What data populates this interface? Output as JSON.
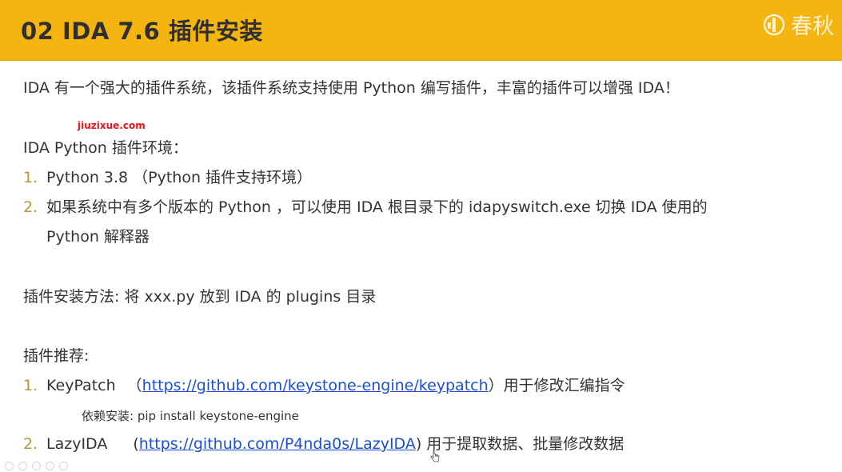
{
  "header": {
    "title": "02 IDA 7.6 插件安装",
    "brand_text": "春秋",
    "accent_color": "#f5b511"
  },
  "intro": "IDA 有一个强大的插件系统，该插件系统支持使用 Python 编写插件，丰富的插件可以增强 IDA！",
  "watermark": "jiuzixue.com",
  "env_section": {
    "heading": "IDA Python 插件环境：",
    "items": [
      {
        "num": "1.",
        "text": "Python 3.8 （Python 插件支持环境）"
      },
      {
        "num": "2.",
        "text": "如果系统中有多个版本的 Python ，可以使用 IDA 根目录下的 idapyswitch.exe 切换 IDA 使用的",
        "continuation": "Python 解释器"
      }
    ]
  },
  "install_method": "插件安装方法: 将 xxx.py 放到 IDA 的 plugins 目录",
  "recommend_section": {
    "heading": "插件推荐:",
    "items": [
      {
        "num": "1.",
        "name": "KeyPatch",
        "open": "（",
        "url": "https://github.com/keystone-engine/keypatch",
        "after": "）用于修改汇编指令",
        "sub_note": "依赖安装: pip install keystone-engine"
      },
      {
        "num": "2.",
        "name": "LazyIDA",
        "open": "(",
        "url": "https://github.com/P4nda0s/LazyIDA",
        "after": ") 用于提取数据、批量修改数据"
      }
    ]
  },
  "icons": {
    "brand_logo": "chunqiu-logo-icon",
    "cursor": "mouse-cursor-icon"
  },
  "colors": {
    "link": "#1a4fcf",
    "list_number": "#b6982e",
    "watermark": "#e8131c"
  }
}
